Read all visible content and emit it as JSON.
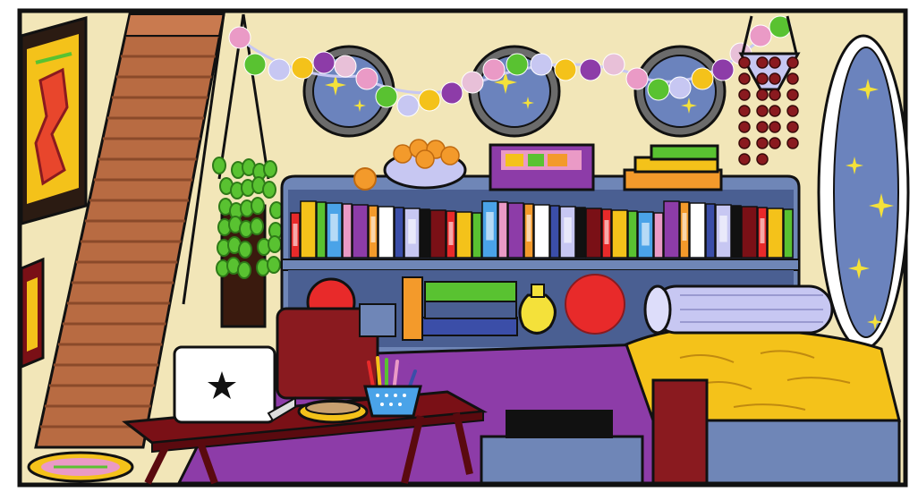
{
  "scene": {
    "subject": "cozy-room-illustration"
  },
  "colors": {
    "wall": "#f2e6b8",
    "outline": "#111111",
    "stair_wood": "#b86b42",
    "stair_shadow": "#8a4a2a",
    "shelf_blue": "#6f86b7",
    "shelf_dark": "#4a5f92",
    "window_blue": "#6b83bd",
    "star_yellow": "#f4e13a",
    "rug_purple": "#8d3ca8",
    "table_maroon": "#7a1016",
    "chair_maroon": "#8a1a1f",
    "blanket_yellow": "#f4c21a",
    "pillow_lavender": "#c7c7f2",
    "plant_green": "#59c231",
    "orange": "#f39a2b",
    "white": "#ffffff"
  },
  "icons": {
    "laptop_logo": "star-icon"
  }
}
